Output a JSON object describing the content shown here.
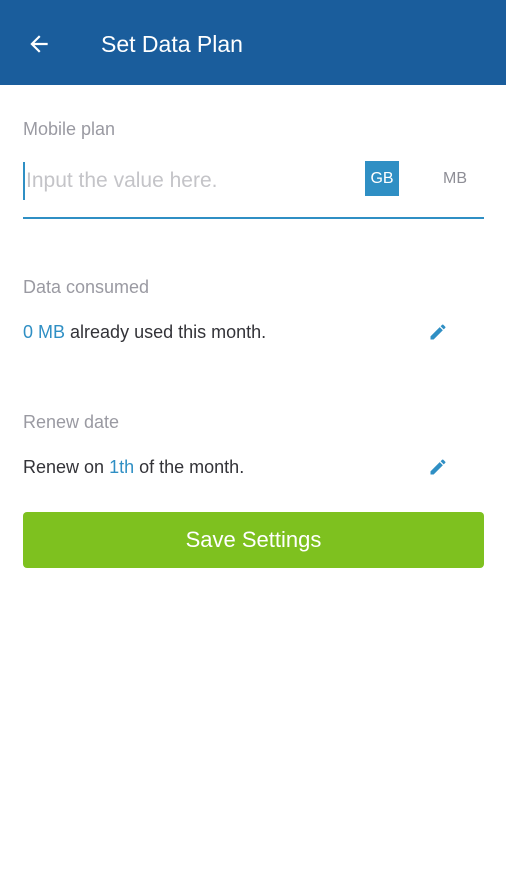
{
  "appbar": {
    "title": "Set Data Plan",
    "back_icon": "arrow-left-icon",
    "color": "#1a5d9c"
  },
  "mobile_plan": {
    "label": "Mobile plan",
    "input_value": "",
    "input_placeholder": "Input the value here.",
    "units": [
      "GB",
      "MB"
    ],
    "selected_unit": "GB"
  },
  "data_consumed": {
    "label": "Data consumed",
    "value": "0 MB",
    "suffix": "already used this month.",
    "edit_icon": "pencil-icon"
  },
  "renew_date": {
    "label": "Renew date",
    "prefix": "Renew on",
    "value": "1th",
    "suffix": "of the month.",
    "edit_icon": "pencil-icon"
  },
  "save_button": {
    "label": "Save Settings",
    "color": "#7ec11f"
  },
  "colors": {
    "accent": "#2f8fc4",
    "muted_label": "#9a9aa2"
  }
}
